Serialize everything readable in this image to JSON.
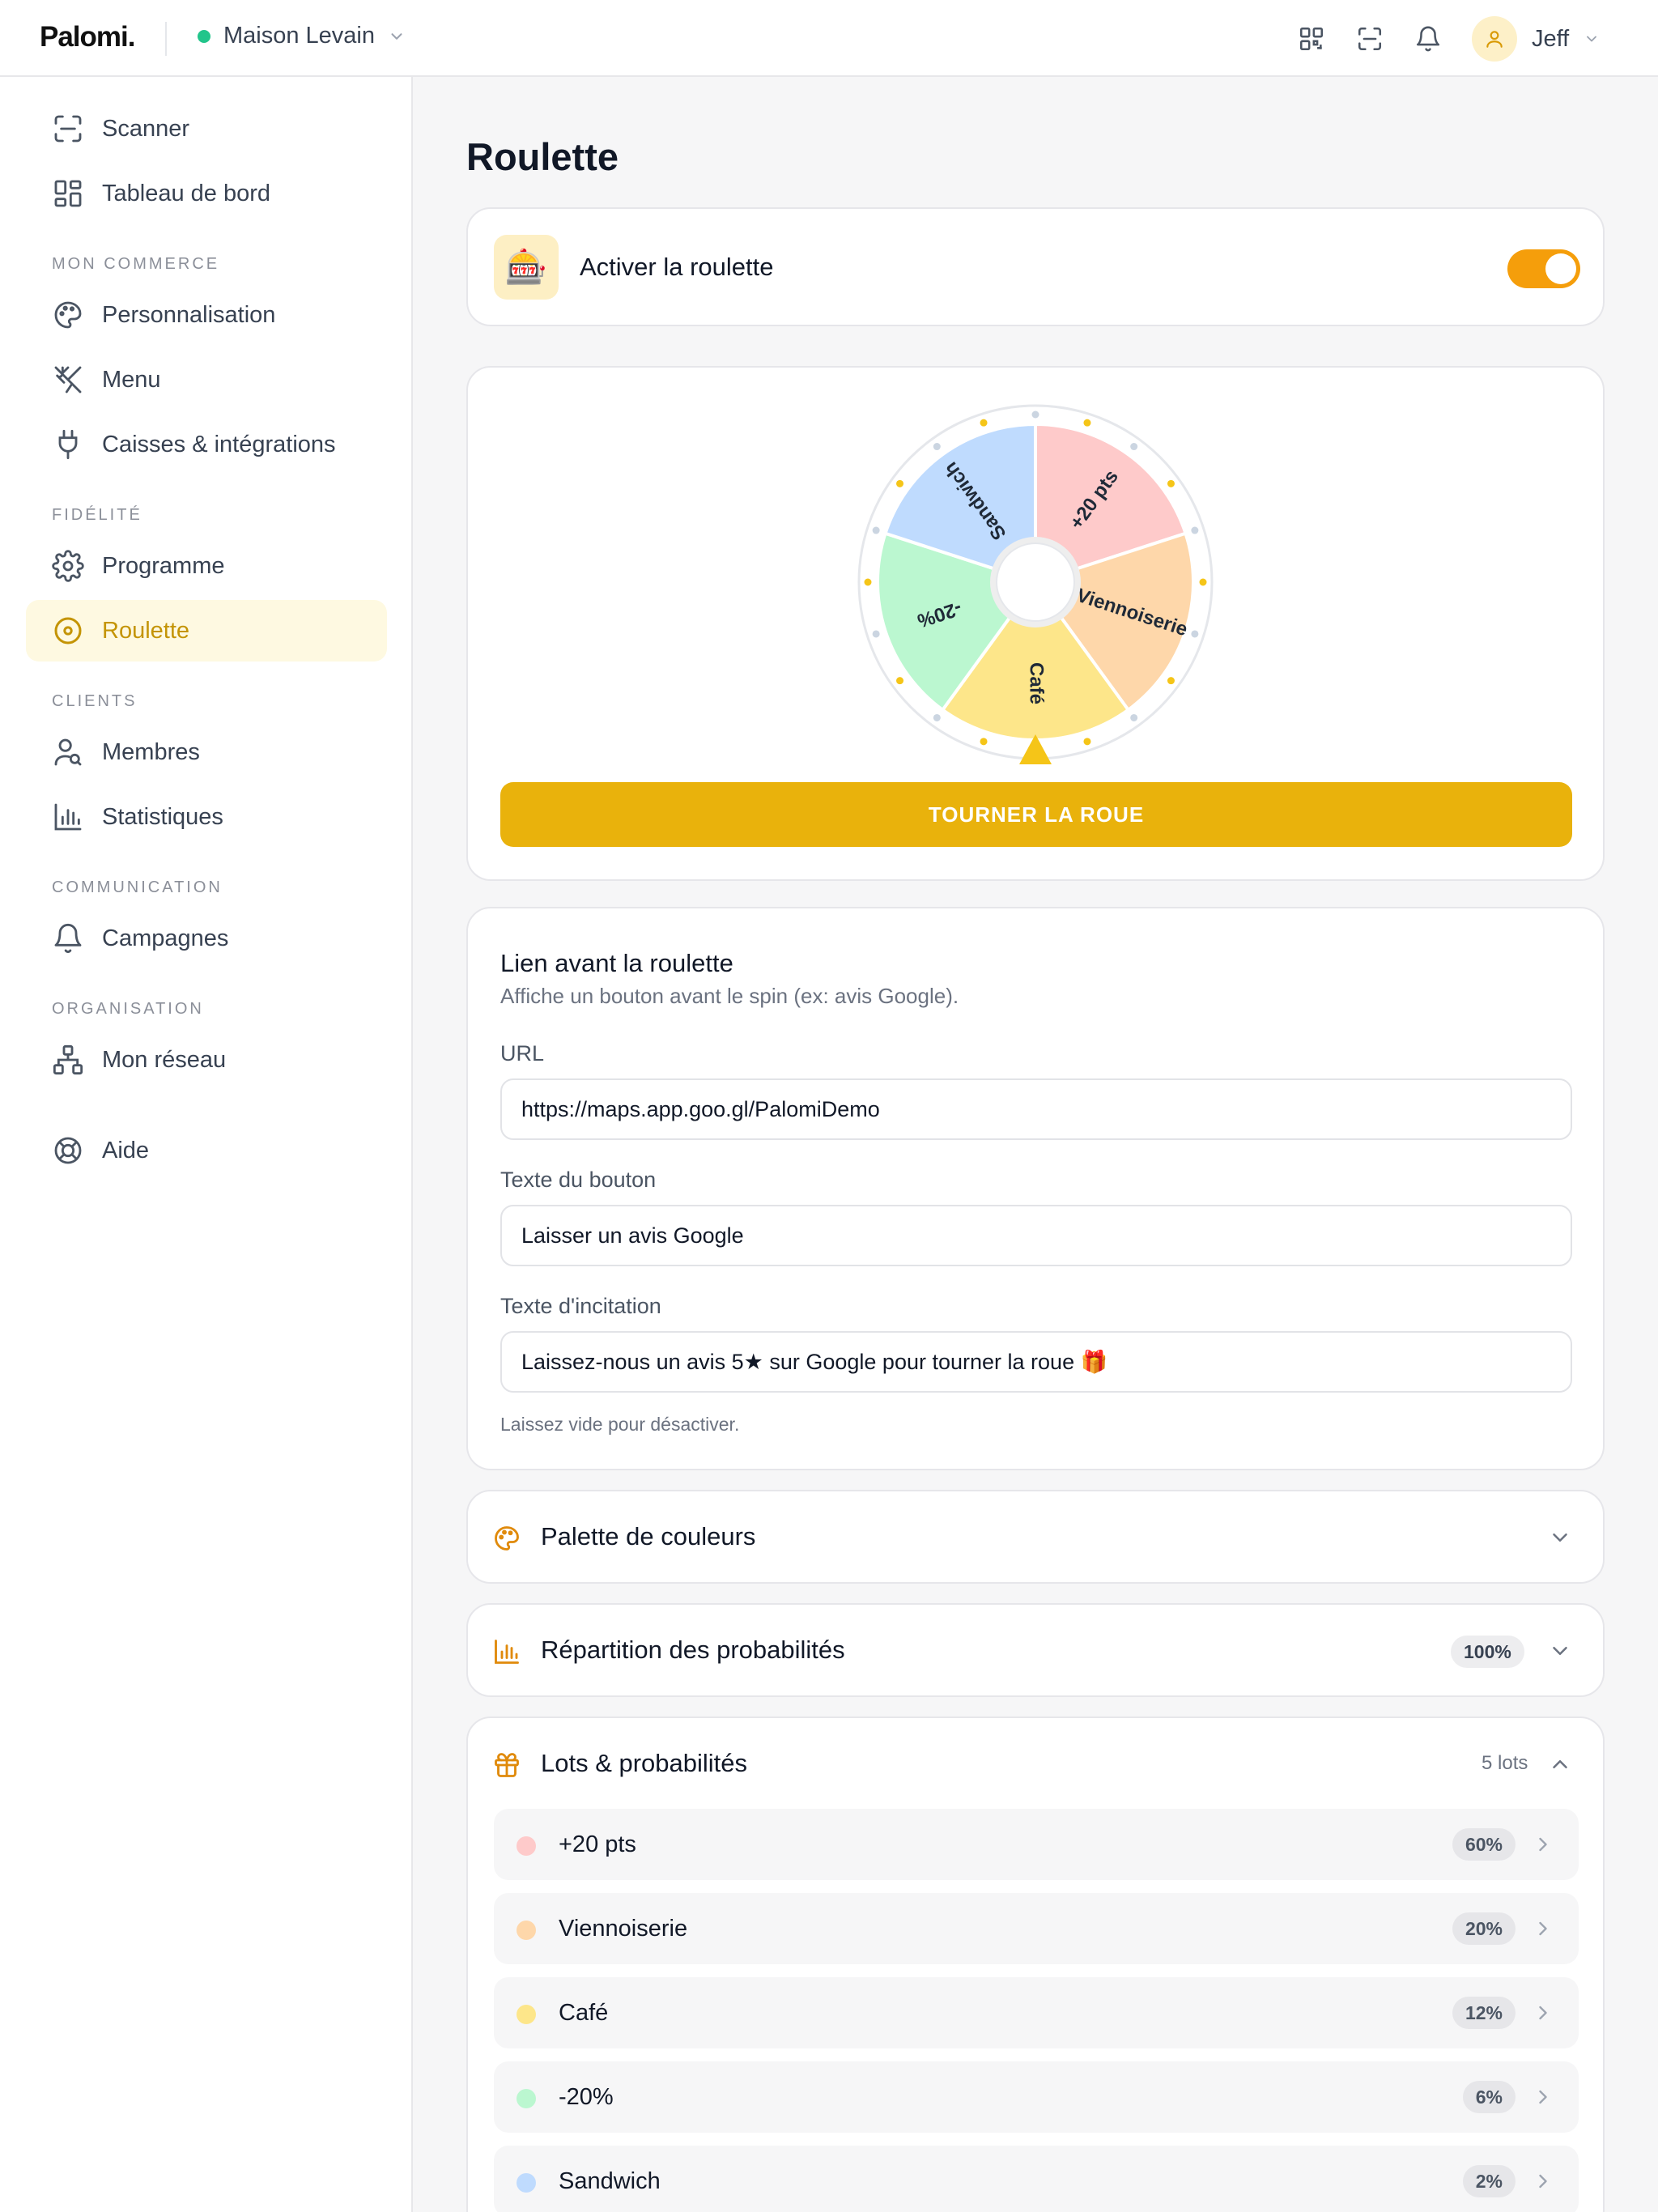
{
  "header": {
    "logo": "Palomi.",
    "shop_name": "Maison Levain",
    "shop_status_color": "#22c58b",
    "icons": [
      "qr-code-icon",
      "scan-icon",
      "bell-icon"
    ],
    "user_name": "Jeff"
  },
  "sidebar": {
    "top_items": [
      {
        "label": "Scanner",
        "icon": "scan-icon"
      },
      {
        "label": "Tableau de bord",
        "icon": "dashboard-icon"
      }
    ],
    "sections": [
      {
        "label": "MON COMMERCE",
        "items": [
          {
            "label": "Personnalisation",
            "icon": "palette-icon"
          },
          {
            "label": "Menu",
            "icon": "utensils-icon"
          },
          {
            "label": "Caisses & intégrations",
            "icon": "plug-icon"
          }
        ]
      },
      {
        "label": "FIDÉLITÉ",
        "items": [
          {
            "label": "Programme",
            "icon": "gear-icon"
          },
          {
            "label": "Roulette",
            "icon": "roulette-icon",
            "active": true
          }
        ]
      },
      {
        "label": "CLIENTS",
        "items": [
          {
            "label": "Membres",
            "icon": "user-search-icon"
          },
          {
            "label": "Statistiques",
            "icon": "bar-chart-icon"
          }
        ]
      },
      {
        "label": "COMMUNICATION",
        "items": [
          {
            "label": "Campagnes",
            "icon": "bell-icon"
          }
        ]
      },
      {
        "label": "ORGANISATION",
        "items": [
          {
            "label": "Mon réseau",
            "icon": "network-icon"
          }
        ]
      }
    ],
    "help": {
      "label": "Aide",
      "icon": "lifebuoy-icon"
    }
  },
  "page": {
    "title": "Roulette",
    "toggle": {
      "emoji": "🎰",
      "label": "Activer la roulette",
      "enabled": true
    },
    "wheel": {
      "spin_label": "TOURNER LA ROUE",
      "segments": [
        {
          "label": "+20 pts",
          "color": "#fecaca"
        },
        {
          "label": "Viennoiserie",
          "color": "#fed7aa"
        },
        {
          "label": "Café",
          "color": "#fde68a"
        },
        {
          "label": "-20%",
          "color": "#bbf7d0"
        },
        {
          "label": "Sandwich",
          "color": "#bfdbfe"
        }
      ]
    },
    "link": {
      "title": "Lien avant la roulette",
      "subtitle": "Affiche un bouton avant le spin (ex: avis Google).",
      "url_label": "URL",
      "url_value": "https://maps.app.goo.gl/PalomiDemo",
      "button_label": "Texte du bouton",
      "button_value": "Laisser un avis Google",
      "prompt_label": "Texte d'incitation",
      "prompt_value": "Laissez-nous un avis 5★ sur Google pour tourner la roue 🎁",
      "hint": "Laissez vide pour désactiver."
    },
    "palette": {
      "title": "Palette de couleurs"
    },
    "distribution": {
      "title": "Répartition des probabilités",
      "total": "100%"
    },
    "lots": {
      "title": "Lots & probabilités",
      "count": "5 lots",
      "items": [
        {
          "name": "+20 pts",
          "pct": "60%",
          "color": "#fecaca"
        },
        {
          "name": "Viennoiserie",
          "pct": "20%",
          "color": "#fed7aa"
        },
        {
          "name": "Café",
          "pct": "12%",
          "color": "#fde68a"
        },
        {
          "name": "-20%",
          "pct": "6%",
          "color": "#bbf7d0"
        },
        {
          "name": "Sandwich",
          "pct": "2%",
          "color": "#bfdbfe"
        }
      ]
    }
  },
  "colors": {
    "accent": "#e9b20c",
    "toggle": "#f59e0b",
    "active_nav_bg": "#fef9e1",
    "active_nav_text": "#c49405"
  }
}
